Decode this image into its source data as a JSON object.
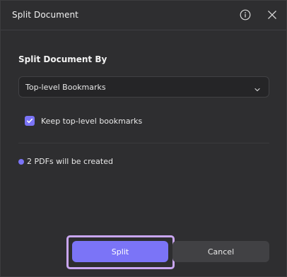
{
  "dialog": {
    "title": "Split Document",
    "info_icon": "info-circle-icon",
    "close_icon": "close-icon"
  },
  "split_by": {
    "heading": "Split Document By",
    "selected": "Top-level Bookmarks",
    "chevron_icon": "chevron-down-icon"
  },
  "keep_bookmarks": {
    "label": "Keep top-level bookmarks",
    "checked": true
  },
  "status": {
    "text": "2 PDFs will be created"
  },
  "buttons": {
    "split_label": "Split",
    "cancel_label": "Cancel"
  },
  "colors": {
    "accent": "#7b74f7",
    "focus_ring": "#c9a6f0",
    "background": "#2e2e30",
    "secondary_button": "#414144"
  }
}
